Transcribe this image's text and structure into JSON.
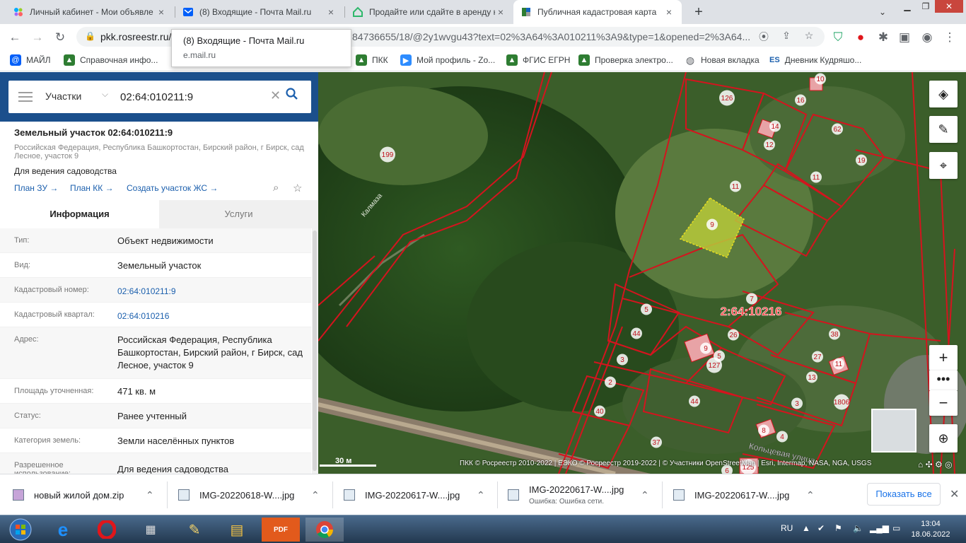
{
  "browser": {
    "tabs": [
      {
        "title": "Личный кабинет - Мои объявле"
      },
      {
        "title": "(8) Входящие - Почта Mail.ru"
      },
      {
        "title": "Продайте или сдайте в аренду н"
      },
      {
        "title": "Публичная кадастровая карта"
      }
    ],
    "url_host": "pkk.rosreestr.ru/",
    "url_rest": "84736655/18/@2y1wvgu43?text=02%3A64%3A010211%3A9&type=1&opened=2%3A64...",
    "tooltip_title": "(8) Входящие - Почта Mail.ru",
    "tooltip_domain": "e.mail.ru",
    "bookmarks": [
      "МАЙЛ",
      "Справочная инфо...",
      "ПКК",
      "Мой профиль - Zo...",
      "ФГИС ЕГРН",
      "Проверка электро...",
      "Новая вкладка",
      "Дневник Кудряшо..."
    ]
  },
  "panel": {
    "search_type": "Участки",
    "search_value": "02:64:010211:9",
    "title": "Земельный участок 02:64:010211:9",
    "address_small": "Российская Федерация, Республика Башкортостан, Бирский район, г Бирск, сад Лесное, участок 9",
    "purpose": "Для ведения садоводства",
    "links": [
      "План ЗУ →",
      "План КК →",
      "Создать участок ЖС →"
    ],
    "tabs": [
      "Информация",
      "Услуги"
    ],
    "rows": [
      {
        "label": "Тип:",
        "value": "Объект недвижимости"
      },
      {
        "label": "Вид:",
        "value": "Земельный участок"
      },
      {
        "label": "Кадастровый номер:",
        "value": "02:64:010211:9"
      },
      {
        "label": "Кадастровый квартал:",
        "value": "02:64:010216"
      },
      {
        "label": "Адрес:",
        "value": "Российская Федерация, Республика Башкортостан, Бирский район, г Бирск, сад Лесное, участок 9"
      },
      {
        "label": "Площадь уточненная:",
        "value": "471 кв. м"
      },
      {
        "label": "Статус:",
        "value": "Ранее учтенный"
      },
      {
        "label": "Категория земель:",
        "value": "Земли населённых пунктов"
      },
      {
        "label": "Разрешенное использование:",
        "value": "Для ведения садоводства"
      }
    ]
  },
  "map": {
    "labels": [
      "199",
      "Калмаза",
      "126",
      "16",
      "10",
      "14",
      "12",
      "62",
      "19",
      "11",
      "11",
      "9",
      "7",
      "2:64:10216",
      "5",
      "44",
      "26",
      "9",
      "5",
      "127",
      "38",
      "27",
      "11",
      "3",
      "2",
      "13",
      "44",
      "3",
      "40",
      "37",
      "8",
      "4",
      "1806",
      "6",
      "125",
      "Кольцевая улица"
    ],
    "scale": "30 м",
    "attribution": "ПКК © Росреестр 2010-2022 | ЕЭКО © Росреестр 2019-2022 | © Участники OpenStreetMap | Esri, Intermap, NASA, NGA, USGS",
    "selected_color": "#b7c93a",
    "boundary_color": "#d4141e"
  },
  "downloads": {
    "items": [
      {
        "name": "новый жилой дом.zip",
        "sub": ""
      },
      {
        "name": "IMG-20220618-W....jpg",
        "sub": ""
      },
      {
        "name": "IMG-20220617-W....jpg",
        "sub": ""
      },
      {
        "name": "IMG-20220617-W....jpg",
        "sub": "Ошибка: Ошибка сети."
      },
      {
        "name": "IMG-20220617-W....jpg",
        "sub": ""
      }
    ],
    "show_all": "Показать все"
  },
  "taskbar": {
    "lang": "RU",
    "time": "13:04",
    "date": "18.06.2022"
  }
}
